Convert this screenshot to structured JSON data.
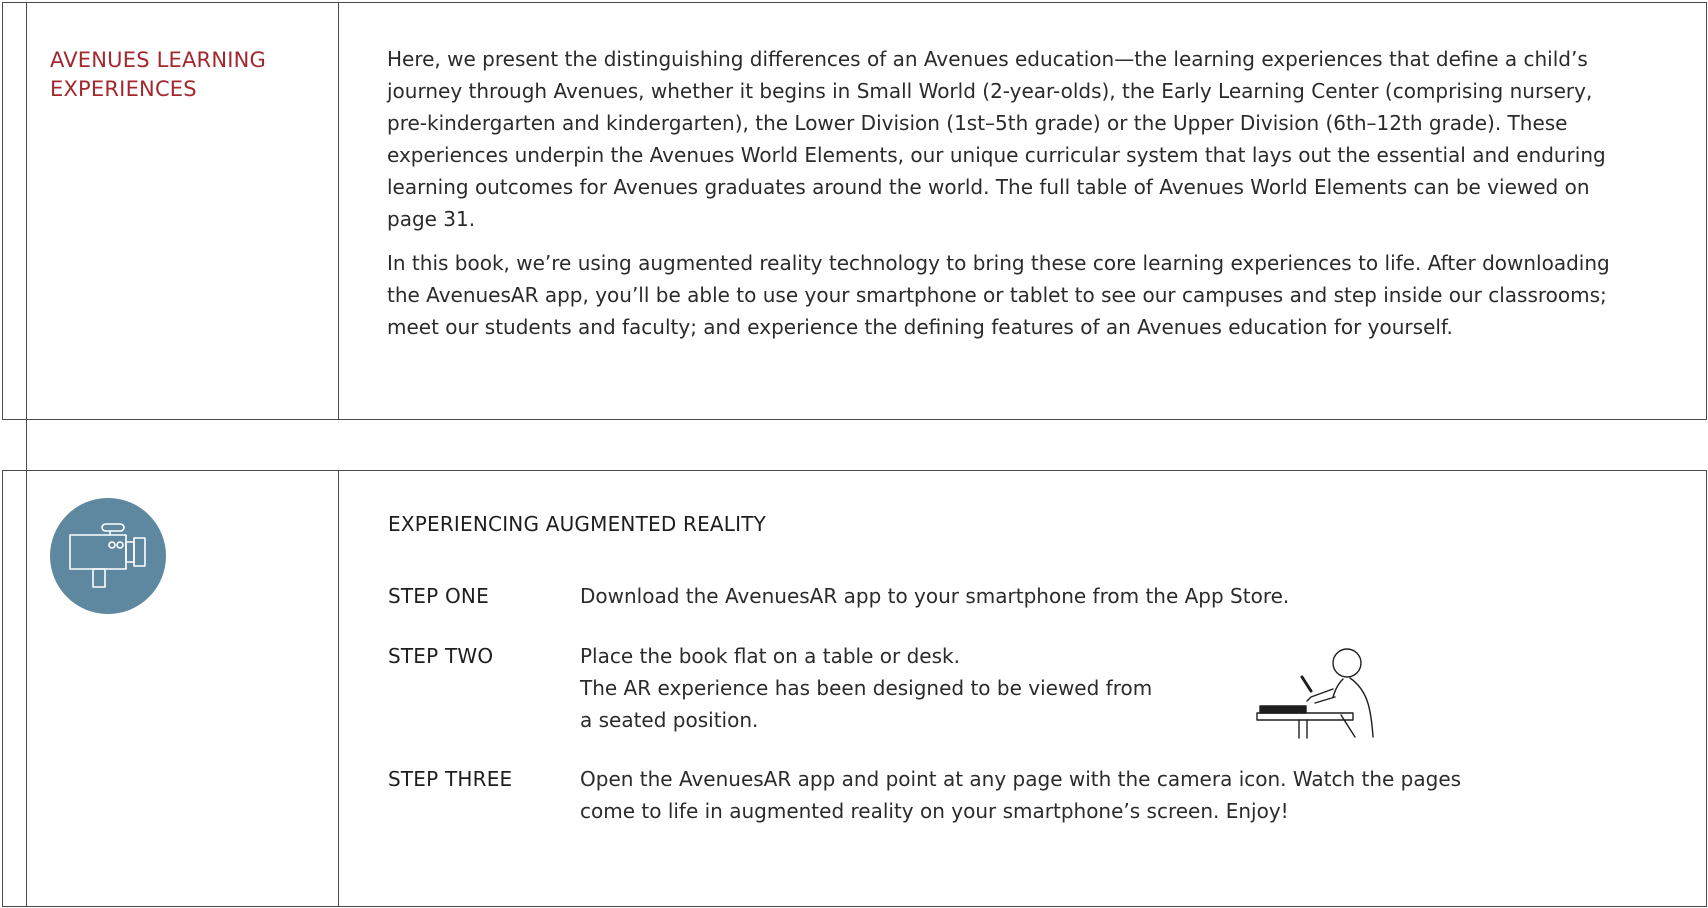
{
  "learning_experiences": {
    "title": "AVENUES LEARNING EXPERIENCES",
    "paragraphs": [
      "Here, we present the distinguishing differences of an Avenues education—the learning experiences that define a child’s journey through Avenues, whether it begins in Small World (2-year-olds), the Early Learning Center (comprising nursery, pre-kindergarten and kindergarten), the Lower Division (1st–5th grade) or the Upper Division (6th–12th grade). These experiences underpin the Avenues World Elements, our unique curricular system that lays out the essential and enduring learning outcomes for Avenues graduates around the world. The full table of Avenues World Elements can be viewed on page 31.",
      "In this book, we’re using augmented reality technology to bring these core learning experiences to life. After downloading the AvenuesAR app, you’ll be able to use your smartphone or tablet to see our campuses and step inside our classrooms; meet our students and faculty; and experience the defining features of an Avenues education for yourself."
    ]
  },
  "augmented_reality": {
    "icon": "video-camera-icon",
    "icon_background": "#5e87a0",
    "heading": "EXPERIENCING AUGMENTED REALITY",
    "steps": [
      {
        "label": "STEP ONE",
        "lines": [
          "Download the AvenuesAR app to your smartphone from the App Store."
        ]
      },
      {
        "label": "STEP TWO",
        "lines": [
          "Place the book flat on a table or desk.",
          "The AR experience has been designed to be viewed from",
          "a seated position."
        ],
        "illustration": "seated-person-reading-icon"
      },
      {
        "label": "STEP THREE",
        "lines": [
          "Open the AvenuesAR app and point at any page with the camera icon. Watch the pages",
          "come to life in augmented reality on your smartphone’s screen. Enjoy!"
        ]
      }
    ]
  },
  "colors": {
    "title_red": "#a3282e",
    "rule_gray": "#4a4a4a",
    "text": "#2b2b2b"
  }
}
